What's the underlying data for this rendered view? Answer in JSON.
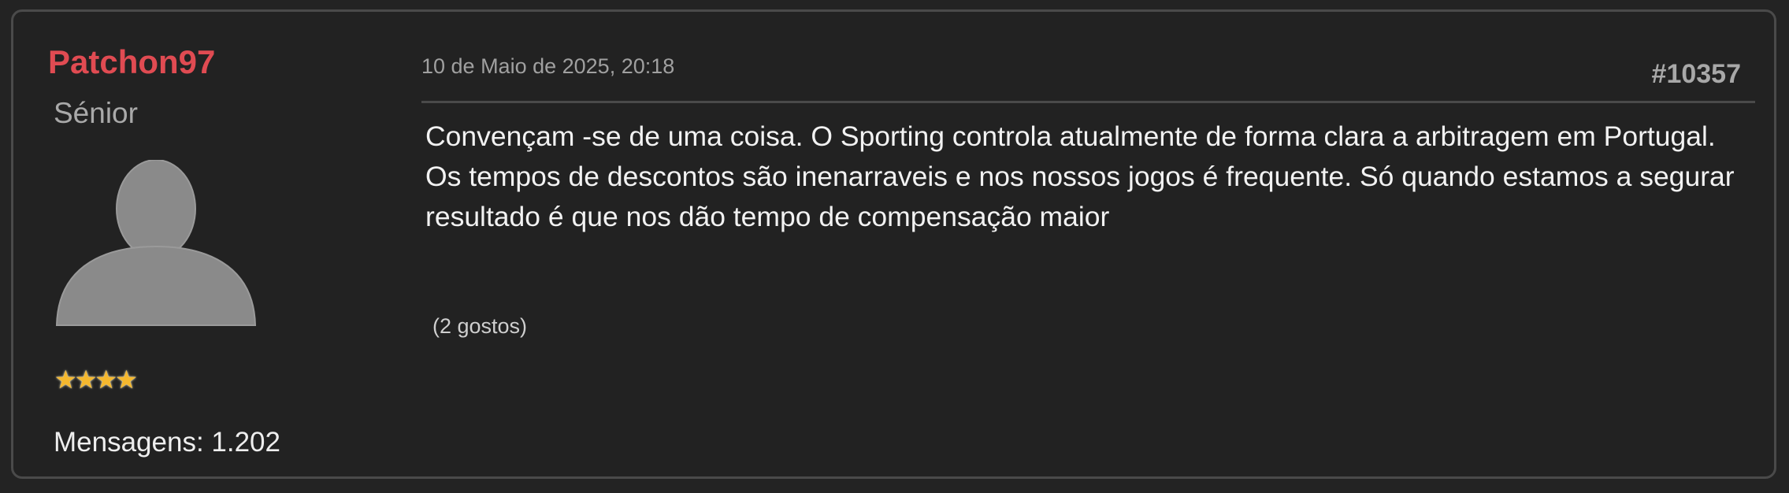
{
  "post": {
    "author": {
      "username": "Patchon97",
      "rank": "Sénior",
      "avatar_icon": "default-user-avatar-icon",
      "stars": "★★★★",
      "star_count": 4,
      "messages": "Mensagens: 1.202"
    },
    "date": "10 de Maio de 2025, 20:18",
    "number": "#10357",
    "body": "Convençam -se de uma coisa. O Sporting controla atualmente de forma clara a arbitragem em Portugal. Os tempos de descontos são inenarraveis e nos nossos jogos é frequente. Só quando estamos a segurar resultado é que nos dão tempo de compensação maior",
    "likes": "(2 gostos)"
  },
  "colors": {
    "username": "#e04b52",
    "background": "#222222",
    "border": "#4a4a4a",
    "star": "#f5b82e"
  }
}
